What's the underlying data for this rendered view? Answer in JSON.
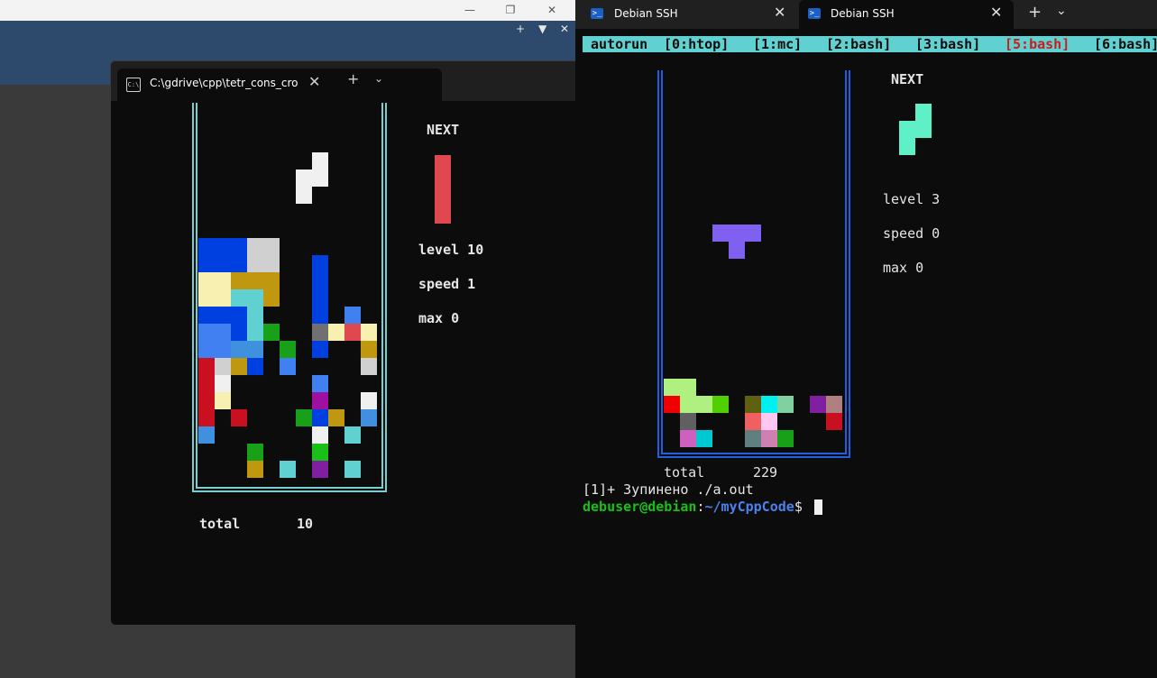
{
  "background_window": {
    "controls": [
      "—",
      "❐",
      "✕"
    ],
    "toolbar_icons": [
      "+",
      "▼",
      "✕"
    ]
  },
  "left_terminal": {
    "tab_title": "C:\\gdrive\\cpp\\tetr_cons_cropl",
    "tab_icon": "C:\\",
    "close_glyph": "✕",
    "newtab_glyph": "+",
    "dropdown_glyph": "⌄",
    "game": {
      "next_label": "NEXT",
      "level_text": "level 10",
      "speed_text": "speed 1",
      "max_text": "max 0",
      "total_label": "total",
      "total_value": "10",
      "border_color": "#7ad0d0",
      "current_piece_color": "#f0f0f0",
      "next_piece_color": "#e04850",
      "current_piece": [
        [
          7,
          3
        ],
        [
          7,
          4
        ],
        [
          6,
          4
        ],
        [
          6,
          5
        ]
      ],
      "next_piece": [
        [
          0,
          0
        ],
        [
          0,
          1
        ],
        [
          0,
          2
        ],
        [
          0,
          3
        ]
      ],
      "stack": [
        [
          0,
          8,
          "#0040e0"
        ],
        [
          1,
          8,
          "#0040e0"
        ],
        [
          2,
          8,
          "#0040e0"
        ],
        [
          3,
          8,
          "#d0d0d0"
        ],
        [
          4,
          8,
          "#d0d0d0"
        ],
        [
          0,
          9,
          "#0040e0"
        ],
        [
          1,
          9,
          "#0040e0"
        ],
        [
          2,
          9,
          "#0040e0"
        ],
        [
          3,
          9,
          "#d0d0d0"
        ],
        [
          4,
          9,
          "#d0d0d0"
        ],
        [
          7,
          9,
          "#0040e0"
        ],
        [
          0,
          10,
          "#f8f0b0"
        ],
        [
          1,
          10,
          "#f8f0b0"
        ],
        [
          2,
          10,
          "#c09810"
        ],
        [
          3,
          10,
          "#c09810"
        ],
        [
          4,
          10,
          "#c09810"
        ],
        [
          7,
          10,
          "#0040e0"
        ],
        [
          0,
          11,
          "#f8f0b0"
        ],
        [
          1,
          11,
          "#f8f0b0"
        ],
        [
          2,
          11,
          "#60d0d0"
        ],
        [
          3,
          11,
          "#60d0d0"
        ],
        [
          4,
          11,
          "#c09810"
        ],
        [
          7,
          11,
          "#0040e0"
        ],
        [
          0,
          12,
          "#0040e0"
        ],
        [
          1,
          12,
          "#0040e0"
        ],
        [
          2,
          12,
          "#0040e0"
        ],
        [
          3,
          12,
          "#60d0d0"
        ],
        [
          7,
          12,
          "#0040e0"
        ],
        [
          9,
          12,
          "#4080f0"
        ],
        [
          0,
          13,
          "#4080f0"
        ],
        [
          1,
          13,
          "#4080f0"
        ],
        [
          2,
          13,
          "#0040e0"
        ],
        [
          3,
          13,
          "#60d0d0"
        ],
        [
          4,
          13,
          "#18a018"
        ],
        [
          7,
          13,
          "#707070"
        ],
        [
          8,
          13,
          "#f8f0b0"
        ],
        [
          9,
          13,
          "#e04850"
        ],
        [
          10,
          13,
          "#f8f0b0"
        ],
        [
          0,
          14,
          "#4080f0"
        ],
        [
          1,
          14,
          "#4080f0"
        ],
        [
          2,
          14,
          "#4090e0"
        ],
        [
          3,
          14,
          "#4090e0"
        ],
        [
          5,
          14,
          "#18a018"
        ],
        [
          7,
          14,
          "#0040e0"
        ],
        [
          10,
          14,
          "#c09810"
        ],
        [
          0,
          15,
          "#c81020"
        ],
        [
          1,
          15,
          "#d0d0d0"
        ],
        [
          2,
          15,
          "#c09810"
        ],
        [
          3,
          15,
          "#0040e0"
        ],
        [
          5,
          15,
          "#4080f0"
        ],
        [
          10,
          15,
          "#d0d0d0"
        ],
        [
          0,
          16,
          "#c81020"
        ],
        [
          1,
          16,
          "#f0f0f0"
        ],
        [
          7,
          16,
          "#4080f0"
        ],
        [
          0,
          17,
          "#c81020"
        ],
        [
          1,
          17,
          "#f8f0b0"
        ],
        [
          7,
          17,
          "#a010a0"
        ],
        [
          10,
          17,
          "#f0f0f0"
        ],
        [
          0,
          18,
          "#c81020"
        ],
        [
          2,
          18,
          "#c81020"
        ],
        [
          6,
          18,
          "#18a018"
        ],
        [
          7,
          18,
          "#0040e0"
        ],
        [
          8,
          18,
          "#c09810"
        ],
        [
          10,
          18,
          "#4090e0"
        ],
        [
          0,
          19,
          "#4090e0"
        ],
        [
          7,
          19,
          "#f0f0f0"
        ],
        [
          9,
          19,
          "#60d0d0"
        ],
        [
          3,
          20,
          "#18a018"
        ],
        [
          7,
          20,
          "#18c018"
        ],
        [
          3,
          21,
          "#c09810"
        ],
        [
          5,
          21,
          "#60d0d0"
        ],
        [
          7,
          21,
          "#8020a0"
        ],
        [
          9,
          21,
          "#60d0d0"
        ]
      ]
    }
  },
  "right_terminal": {
    "tabs": [
      {
        "title": "Debian SSH",
        "active": false
      },
      {
        "title": "Debian SSH",
        "active": true
      }
    ],
    "tab_icon": ">_",
    "close_glyph": "✕",
    "newtab_glyph": "+",
    "dropdown_glyph": "⌄",
    "status_bar": {
      "items": [
        "autorun",
        "[0:htop]",
        "[1:mc]",
        "[2:bash]",
        "[3:bash]",
        "[5:bash]",
        "[6:bash]"
      ],
      "active_index": 5,
      "bg_color": "#60d0d0",
      "active_color": "#c81e1e"
    },
    "game": {
      "next_label": "NEXT",
      "level_text": "level 3",
      "speed_text": "speed 0",
      "max_text": "max 0",
      "total_label": "total",
      "total_value": "229",
      "border_color": "#2060e0",
      "current_piece_color": "#8060f0",
      "next_piece_color": "#60f0c8",
      "current_piece": [
        [
          3,
          9
        ],
        [
          4,
          9
        ],
        [
          5,
          9
        ],
        [
          4,
          10
        ]
      ],
      "next_piece": [
        [
          1,
          0
        ],
        [
          1,
          1
        ],
        [
          0,
          1
        ],
        [
          0,
          2
        ]
      ],
      "stack": [
        [
          0,
          18,
          "#b0f080"
        ],
        [
          1,
          18,
          "#b0f080"
        ],
        [
          0,
          19,
          "#f00000"
        ],
        [
          1,
          19,
          "#b0f080"
        ],
        [
          2,
          19,
          "#b0f080"
        ],
        [
          3,
          19,
          "#50d000"
        ],
        [
          5,
          19,
          "#606010"
        ],
        [
          6,
          19,
          "#00f0f0"
        ],
        [
          7,
          19,
          "#80d0a0"
        ],
        [
          9,
          19,
          "#8020a0"
        ],
        [
          10,
          19,
          "#b08080"
        ],
        [
          1,
          20,
          "#606060"
        ],
        [
          5,
          20,
          "#f06060"
        ],
        [
          6,
          20,
          "#ffc8f0"
        ],
        [
          10,
          20,
          "#c81020"
        ],
        [
          1,
          21,
          "#d060c0"
        ],
        [
          2,
          21,
          "#00c8d0"
        ],
        [
          5,
          21,
          "#608080"
        ],
        [
          6,
          21,
          "#d080b0"
        ],
        [
          7,
          21,
          "#18a018"
        ]
      ]
    },
    "terminal_lines": {
      "job_line": "[1]+  Зупинено        ./a.out",
      "prompt_user": "debuser@debian",
      "prompt_sep": ":",
      "prompt_path": "~/myCppCode",
      "prompt_end": "$"
    }
  }
}
